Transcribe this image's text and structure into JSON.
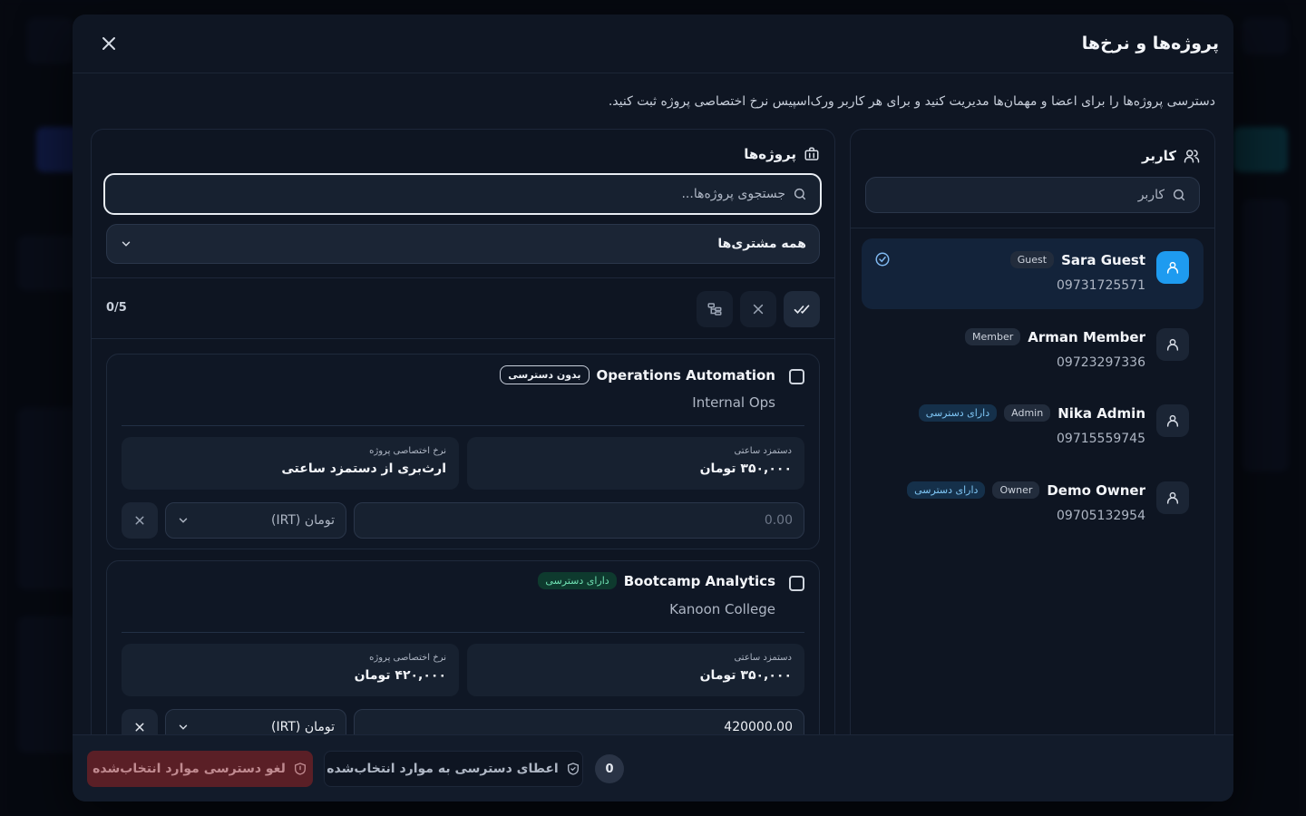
{
  "modal": {
    "title": "پروژه‌ها و نرخ‌ها",
    "description": "دسترسی پروژه‌ها را برای اعضا و مهمان‌ها مدیریت کنید و برای هر کاربر ورک‌اسپیس نرخ اختصاصی پروژه ثبت کنید."
  },
  "users": {
    "heading": "کاربر",
    "search_placeholder": "کاربر",
    "items": [
      {
        "name": "Sara Guest",
        "role": "Guest",
        "phone": "09731725571",
        "access": ""
      },
      {
        "name": "Arman Member",
        "role": "Member",
        "phone": "09723297336",
        "access": ""
      },
      {
        "name": "Nika Admin",
        "role": "Admin",
        "phone": "09715559745",
        "access": "دارای دسترسی"
      },
      {
        "name": "Demo Owner",
        "role": "Owner",
        "phone": "09705132954",
        "access": "دارای دسترسی"
      }
    ]
  },
  "projects": {
    "heading": "پروژه‌ها",
    "search_placeholder": "جستجوی پروژه‌ها...",
    "client_filter": "همه مشتری‌ها",
    "counter": "0/5",
    "items": [
      {
        "title": "Operations Automation",
        "client": "Internal Ops",
        "status": "بدون دسترسی",
        "hourly_label": "دستمزد ساعتی",
        "hourly_value": "۳۵۰,۰۰۰ تومان",
        "custom_label": "نرخ اختصاصی پروژه",
        "custom_value": "ارث‌بری از دستمزد ساعتی",
        "rate_input_value": "",
        "rate_input_placeholder": "0.00",
        "currency": "تومان (IRT)"
      },
      {
        "title": "Bootcamp Analytics",
        "client": "Kanoon College",
        "status": "دارای دسترسی",
        "hourly_label": "دستمزد ساعتی",
        "hourly_value": "۳۵۰,۰۰۰ تومان",
        "custom_label": "نرخ اختصاصی پروژه",
        "custom_value": "۴۲۰,۰۰۰ تومان",
        "rate_input_value": "420000.00",
        "rate_input_placeholder": "0.00",
        "currency": "تومان (IRT)"
      }
    ]
  },
  "footer": {
    "selected_count": "0",
    "grant_label": "اعطای دسترسی به موارد انتخاب‌شده",
    "revoke_label": "لغو دسترسی موارد انتخاب‌شده"
  }
}
